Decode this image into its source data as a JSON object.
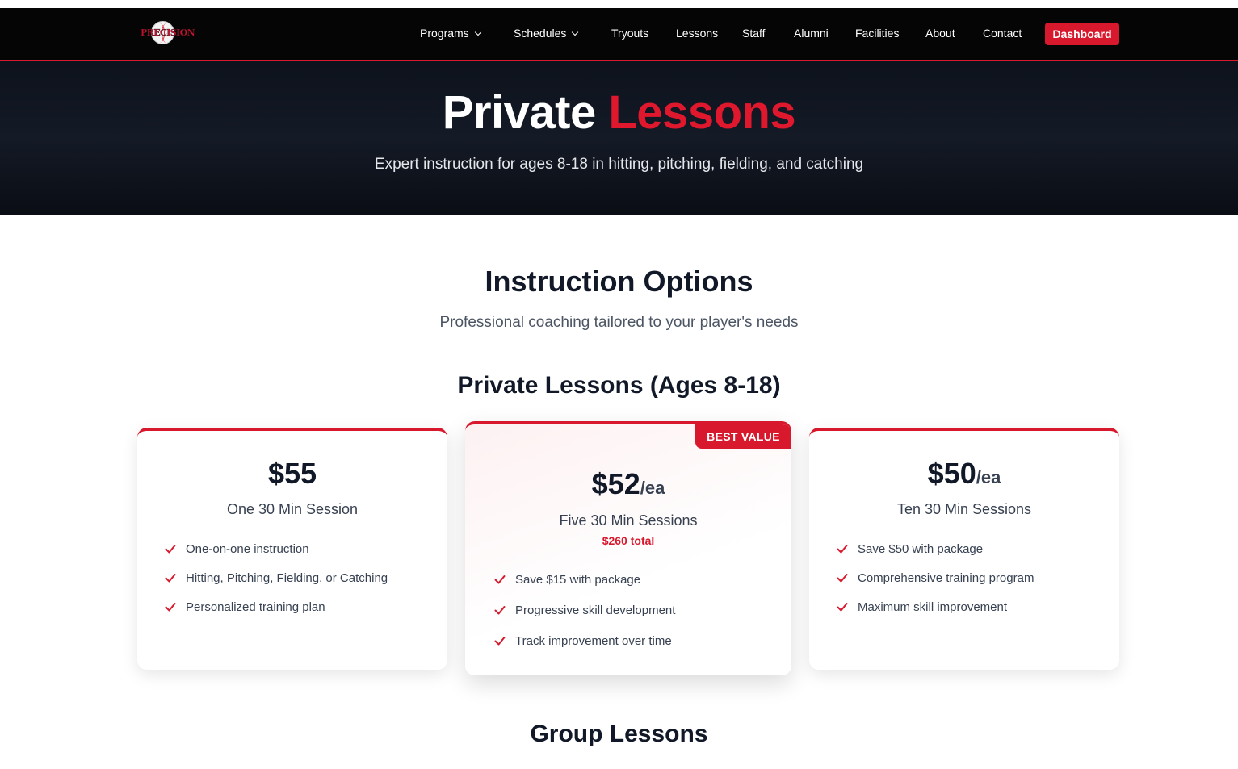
{
  "brand": {
    "logo_text": "PRECISION"
  },
  "nav": {
    "items": [
      {
        "label": "Programs",
        "dropdown": true
      },
      {
        "label": "Schedules",
        "dropdown": true
      },
      {
        "label": "Tryouts"
      },
      {
        "label": "Lessons"
      },
      {
        "label": "Staff"
      },
      {
        "label": "Alumni"
      },
      {
        "label": "Facilities"
      },
      {
        "label": "About"
      },
      {
        "label": "Contact"
      }
    ],
    "cta": "Dashboard"
  },
  "hero": {
    "title_part1": "Private",
    "title_part2": "Lessons",
    "subtitle": "Expert instruction for ages 8-18 in hitting, pitching, fielding, and catching"
  },
  "section": {
    "title": "Instruction Options",
    "subtitle": "Professional coaching tailored to your player's needs",
    "private_title": "Private Lessons (Ages 8-18)",
    "group_title": "Group Lessons"
  },
  "plans": [
    {
      "price": "$55",
      "unit": "",
      "name": "One 30 Min Session",
      "features": [
        "One-on-one instruction",
        "Hitting, Pitching, Fielding, or Catching",
        "Personalized training plan"
      ]
    },
    {
      "badge": "BEST VALUE",
      "price": "$52",
      "unit": "/ea",
      "name": "Five 30 Min Sessions",
      "total": "$260 total",
      "features": [
        "Save $15 with package",
        "Progressive skill development",
        "Track improvement over time"
      ]
    },
    {
      "price": "$50",
      "unit": "/ea",
      "name": "Ten 30 Min Sessions",
      "features": [
        "Save $50 with package",
        "Comprehensive training program",
        "Maximum skill improvement"
      ]
    }
  ],
  "colors": {
    "accent": "#d8192d",
    "nav_bg": "#050505",
    "hero_bg": "#0f1420",
    "text": "#111827"
  },
  "icons": {
    "feature": "check-icon",
    "dropdown": "chevron-down-icon"
  }
}
